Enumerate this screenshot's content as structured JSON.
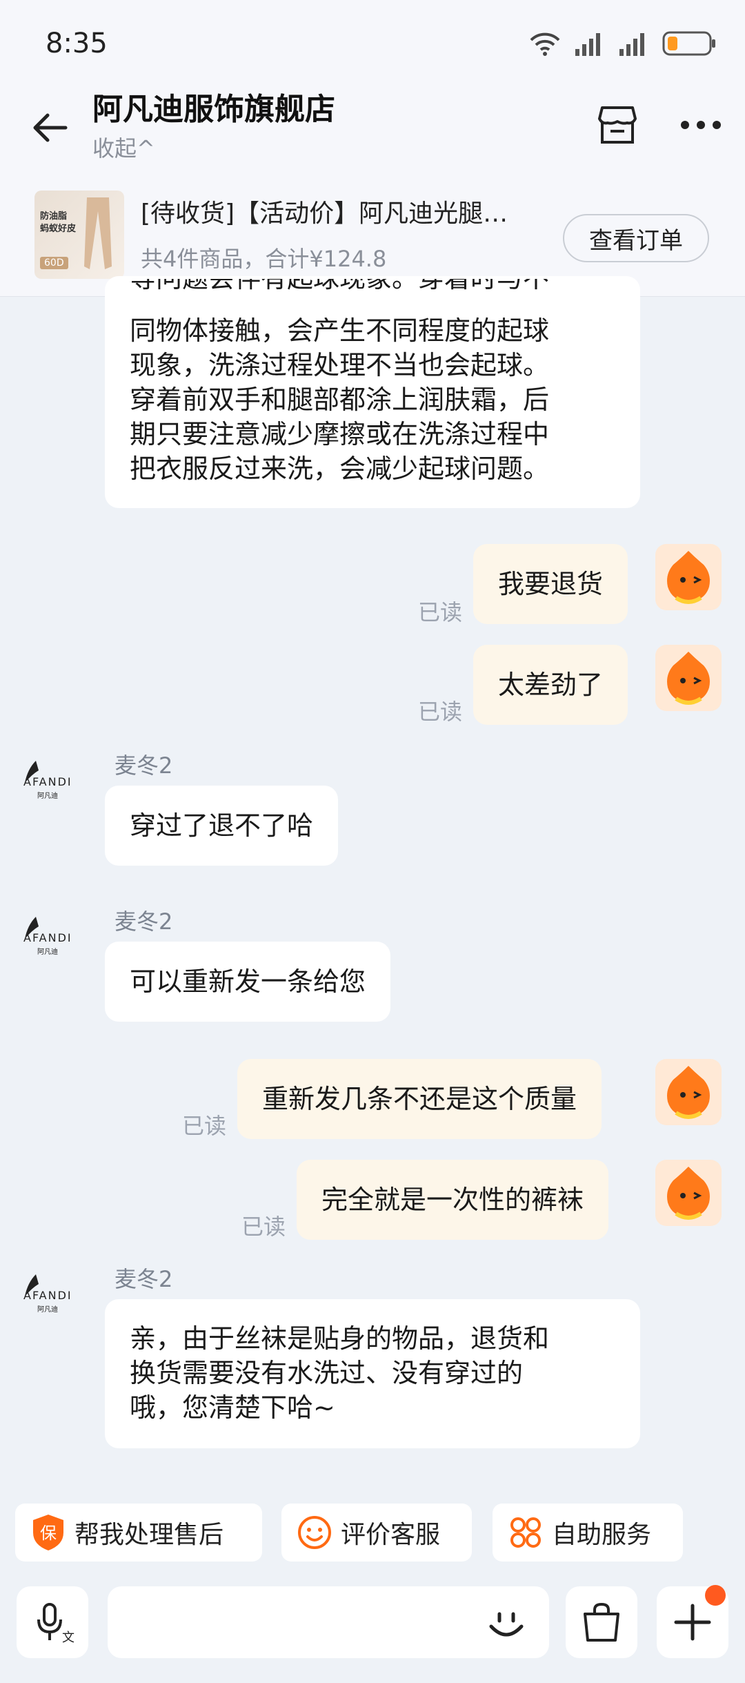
{
  "status_bar": {
    "time": "8:35"
  },
  "header": {
    "shop_name": "阿凡迪服饰旗舰店",
    "collapse_label": "收起^",
    "order": {
      "title": "[待收货]【活动价】阿凡迪光腿…",
      "summary": "共4件商品，合计¥124.8",
      "view_order_label": "查看订单",
      "thumb_line1": "防油脂",
      "thumb_line2": "蚂蚁好皮",
      "thumb_badge": "60D"
    }
  },
  "messages": {
    "first_lines": [
      "等问题会伴有起球现象。穿着时与不",
      "同物体接触，会产生不同程度的起球",
      "现象，洗涤过程处理不当也会起球。",
      "穿着前双手和腿部都涂上润肤霜，后",
      "期只要注意减少摩擦或在洗涤过程中",
      "把衣服反过来洗，会减少起球问题。"
    ],
    "me1": "我要退货",
    "me2": "太差劲了",
    "agent_name": "麦冬2",
    "agent1": "穿过了退不了哈",
    "agent2": "可以重新发一条给您",
    "me3": "重新发几条不还是这个质量",
    "me4": "完全就是一次性的裤袜",
    "agent3_lines": [
      "亲，由于丝袜是贴身的物品，退货和",
      "换货需要没有水洗过、没有穿过的",
      "哦，您清楚下哈~"
    ],
    "read_label": "已读"
  },
  "quick_actions": {
    "after_sale": "帮我处理售后",
    "after_sale_icon_text": "保",
    "rate": "评价客服",
    "self_service": "自助服务"
  },
  "input": {
    "placeholder": "",
    "voice_icon_text": "文"
  },
  "colors": {
    "accent_orange": "#ff6a13",
    "me_bubble": "#fdf6e9",
    "background": "#eef2f7"
  },
  "brand": {
    "logo_text": "AFANDI",
    "logo_sub": "阿凡迪"
  }
}
